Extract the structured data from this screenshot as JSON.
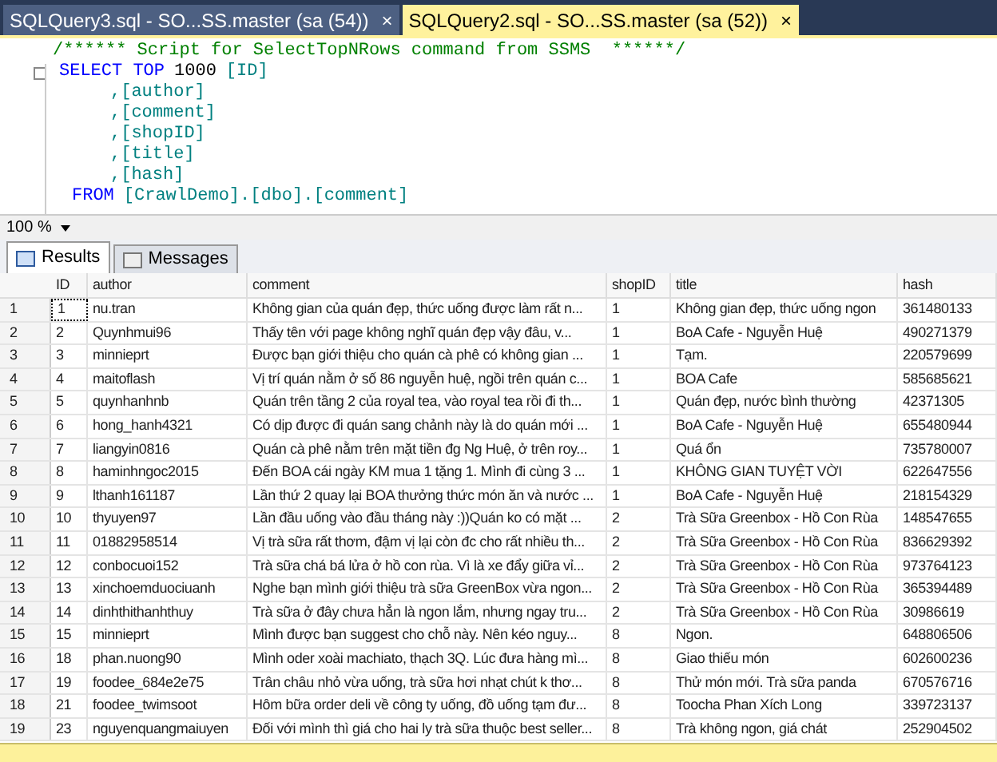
{
  "tabs": [
    {
      "label": "SQLQuery3.sql - SO...SS.master (sa (54))",
      "close": "×",
      "selected": false
    },
    {
      "label": "SQLQuery2.sql - SO...SS.master (sa (52))",
      "close": "×",
      "selected": true
    }
  ],
  "editor": {
    "lines": [
      {
        "kind": "comment",
        "text": "/****** Script for SelectTopNRows command from SSMS  ******/"
      },
      {
        "kind": "select",
        "keyword": "SELECT TOP",
        "number": "1000",
        "field": "[ID]"
      },
      {
        "kind": "field",
        "text": ",[author]"
      },
      {
        "kind": "field",
        "text": ",[comment]"
      },
      {
        "kind": "field",
        "text": ",[shopID]"
      },
      {
        "kind": "field",
        "text": ",[title]"
      },
      {
        "kind": "field",
        "text": ",[hash]"
      },
      {
        "kind": "from",
        "keyword": "FROM",
        "field": "[CrawlDemo].[dbo].[comment]"
      }
    ]
  },
  "zoom": "100 %",
  "result_tabs": [
    {
      "label": "Results",
      "selected": true
    },
    {
      "label": "Messages",
      "selected": false
    }
  ],
  "table": {
    "columns": [
      "ID",
      "author",
      "comment",
      "shopID",
      "title",
      "hash"
    ],
    "rows": [
      {
        "n": "1",
        "cells": [
          "1",
          "nu.tran",
          "Không gian của quán đẹp, thức uống được làm rất n...",
          "1",
          "Không gian đẹp, thức uống ngon",
          "361480133"
        ],
        "selected": true
      },
      {
        "n": "2",
        "cells": [
          "2",
          "Quynhmui96",
          "Thấy tên với page không nghĩ  quán đẹp vậy đâu, v...",
          "1",
          "BoA Cafe - Nguyễn Huệ",
          "490271379"
        ],
        "selected": false
      },
      {
        "n": "3",
        "cells": [
          "3",
          "minnieprt",
          "Được bạn giới thiệu cho quán cà phê có không gian ...",
          "1",
          "Tạm.",
          "220579699"
        ],
        "selected": false
      },
      {
        "n": "4",
        "cells": [
          "4",
          "maitoflash",
          "Vị trí quán nằm ở số 86 nguyễn huệ, ngồi trên quán c...",
          "1",
          "BOA Cafe",
          "585685621"
        ],
        "selected": false
      },
      {
        "n": "5",
        "cells": [
          "5",
          "quynhanhnb",
          "Quán trên tầng 2 của royal tea, vào royal tea rồi đi th...",
          "1",
          "Quán đẹp, nước bình thường",
          "42371305"
        ],
        "selected": false
      },
      {
        "n": "6",
        "cells": [
          "6",
          "hong_hanh4321",
          "Có dịp được đi quán sang chảnh này là do quán mới ...",
          "1",
          "BoA Cafe - Nguyễn Huệ",
          "655480944"
        ],
        "selected": false
      },
      {
        "n": "7",
        "cells": [
          "7",
          "liangyin0816",
          "Quán cà phê nằm trên mặt tiền đg Ng Huệ, ở trên roy...",
          "1",
          "Quá ổn",
          "735780007"
        ],
        "selected": false
      },
      {
        "n": "8",
        "cells": [
          "8",
          "haminhngoc2015",
          "Đến BOA cái ngày KM mua 1 tặng 1. Mình đi cùng 3 ...",
          "1",
          "KHÔNG GIAN TUYỆT VỜI",
          "622647556"
        ],
        "selected": false
      },
      {
        "n": "9",
        "cells": [
          "9",
          "lthanh161187",
          "Lần thứ 2 quay lại BOA thưởng thức món ăn và nước ...",
          "1",
          "BoA Cafe - Nguyễn Huệ",
          "218154329"
        ],
        "selected": false
      },
      {
        "n": "10",
        "cells": [
          "10",
          "thyuyen97",
          "Lần đầu uống vào đầu tháng này :))Quán ko có mặt ...",
          "2",
          "Trà Sữa Greenbox - Hồ Con Rùa",
          "148547655"
        ],
        "selected": false
      },
      {
        "n": "11",
        "cells": [
          "11",
          "01882958514",
          "Vị trà sữa rất thơm, đậm vị lại còn đc cho rất nhiều th...",
          "2",
          "Trà Sữa Greenbox - Hồ Con Rùa",
          "836629392"
        ],
        "selected": false
      },
      {
        "n": "12",
        "cells": [
          "12",
          "conbocuoi152",
          "Trà sữa chá bá lửa ở hồ con rùa. Vì là xe đẩy giữa vỉ...",
          "2",
          "Trà Sữa Greenbox - Hồ Con Rùa",
          "973764123"
        ],
        "selected": false
      },
      {
        "n": "13",
        "cells": [
          "13",
          "xinchoemduociuanh",
          "Nghe bạn mình giới thiệu trà sữa GreenBox vừa ngon...",
          "2",
          "Trà Sữa Greenbox - Hồ Con Rùa",
          "365394489"
        ],
        "selected": false
      },
      {
        "n": "14",
        "cells": [
          "14",
          "dinhthithanhthuy",
          "Trà sữa ở đây chưa hẳn là ngon lắm, nhưng ngay tru...",
          "2",
          "Trà Sữa Greenbox - Hồ Con Rùa",
          "30986619"
        ],
        "selected": false
      },
      {
        "n": "15",
        "cells": [
          "15",
          "minnieprt",
          "Mình được bạn suggest cho chỗ này. Nên kéo nguy...",
          "8",
          "Ngon.",
          "648806506"
        ],
        "selected": false
      },
      {
        "n": "16",
        "cells": [
          "18",
          "phan.nuong90",
          "Mình oder xoài machiato, thạch 3Q. Lúc đưa hàng mì...",
          "8",
          "Giao thiếu món",
          "602600236"
        ],
        "selected": false
      },
      {
        "n": "17",
        "cells": [
          "19",
          "foodee_684e2e75",
          "Trân châu nhỏ vừa uống, trà sữa hơi nhạt chút k thơ...",
          "8",
          "Thử món mới. Trà sữa panda",
          "670576716"
        ],
        "selected": false
      },
      {
        "n": "18",
        "cells": [
          "21",
          "foodee_twimsoot",
          "Hôm bữa order deli về công ty uống, đồ uống tạm đư...",
          "8",
          "Toocha Phan Xích Long",
          "339723137"
        ],
        "selected": false
      },
      {
        "n": "19",
        "cells": [
          "23",
          "nguyenquangmaiuyen",
          "Đối với mình thì giá cho hai ly trà sữa thuộc best seller...",
          "8",
          "Trà không ngon, giá chát",
          "252904502"
        ],
        "selected": false
      }
    ]
  }
}
